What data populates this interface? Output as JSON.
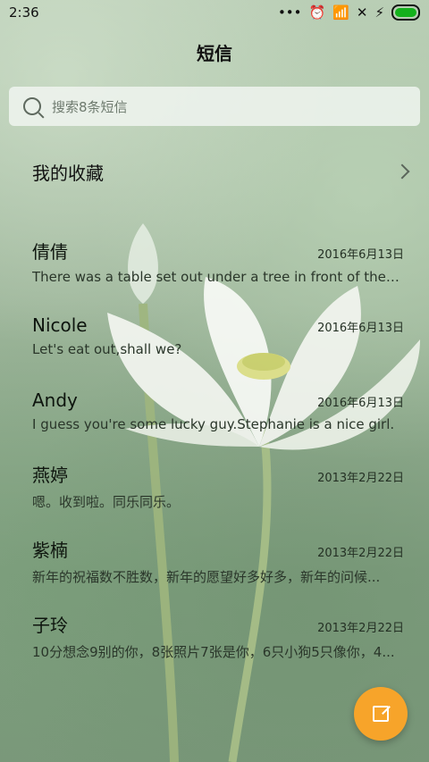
{
  "status": {
    "time": "2:36"
  },
  "app": {
    "title": "短信"
  },
  "search": {
    "placeholder": "搜索8条短信"
  },
  "favorites": {
    "label": "我的收藏"
  },
  "conversations": [
    {
      "name": "倩倩",
      "date": "2016年6月13日",
      "preview": "There was a table set out under a tree in front of the ho..."
    },
    {
      "name": "Nicole",
      "date": "2016年6月13日",
      "preview": "Let's eat out,shall we?"
    },
    {
      "name": "Andy",
      "date": "2016年6月13日",
      "preview": "I guess you're some lucky guy.Stephanie is a nice girl."
    },
    {
      "name": "燕婷",
      "date": "2013年2月22日",
      "preview": "嗯。收到啦。同乐同乐。"
    },
    {
      "name": "紫楠",
      "date": "2013年2月22日",
      "preview": "新年的祝福数不胜数，新年的愿望好多好多，新年的问候..."
    },
    {
      "name": "子玲",
      "date": "2013年2月22日",
      "preview": "10分想念9别的你，8张照片7张是你，6只小狗5只像你，4..."
    }
  ],
  "colors": {
    "fab": "#f7a42a",
    "battery": "#14b11c"
  },
  "icons": [
    "search-icon",
    "chevron-right-icon",
    "compose-icon",
    "wifi-icon",
    "alarm-icon",
    "battery-icon"
  ]
}
